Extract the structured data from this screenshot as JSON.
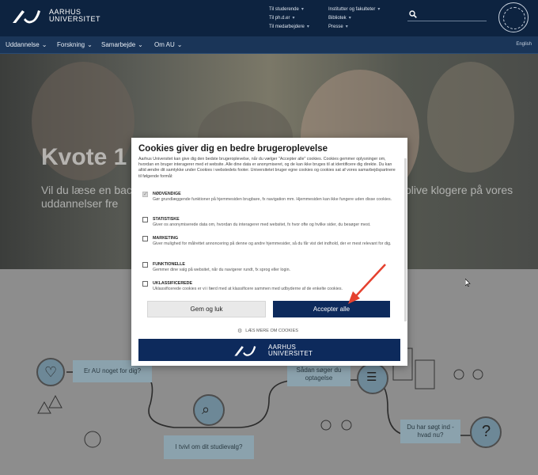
{
  "header": {
    "logo_line1": "AARHUS",
    "logo_line2": "UNIVERSITET",
    "links_col1": [
      "Til studerende",
      "Til ph.d.er",
      "Til medarbejdere"
    ],
    "links_col2": [
      "Institutter og fakulteter",
      "Bibliotek",
      "Presse"
    ],
    "search_placeholder": ""
  },
  "nav": {
    "items": [
      "Uddannelse",
      "Forskning",
      "Samarbejde",
      "Om AU"
    ],
    "language": "English"
  },
  "hero": {
    "title": "Kvote 1",
    "subtitle": "Vil du læse en bach",
    "subtitle_line2": "uddannelser fre",
    "subtitle_right": "blive klogere på vores"
  },
  "flow": {
    "box1": "Er AU noget for dig?",
    "box2": "I tvivl om dit studievalg?",
    "box3": "Sådan søger du optagelse",
    "box4": "Du har søgt ind - hvad nu?"
  },
  "cookie_dialog": {
    "title": "Cookies giver dig en bedre brugeroplevelse",
    "intro": "Aarhus Universitet kan give dig den bedste brugeroplevelse, når du vælger \"Accepter alle\" cookies. Cookies gemmer oplysninger om, hvordan en bruger interagerer med et website. Alle dine data er anonymiseret, og de kan ikke bruges til at identificere dig direkte. Du kan altid ændre dit samtykke under Cookies i webstedets footer. Universitetet bruger egne cookies og cookies sat af vores samarbejdspartnere til følgende formål:",
    "categories": [
      {
        "name": "NØDVENDIGE",
        "desc": "Gør grundlæggende funktioner på hjemmesiden brugbare, fx navigation mm. Hjemmesiden kan ikke fungere uden disse cookies.",
        "checked": true
      },
      {
        "name": "STATISTISKE",
        "desc": "Giver os anonymiserede data om, hvordan du interagerer med websitet, fx hvor ofte og hvilke sider, du besøger mest.",
        "checked": false
      },
      {
        "name": "MARKETING",
        "desc": "Giver mulighed for målrettet annoncering på denne og andre hjemmesider, så du får vist det indhold, der er mest relevant for dig.",
        "checked": false
      },
      {
        "name": "FUNKTIONELLE",
        "desc": "Gemmer dine valg på websitet, når du navigerer rundt, fx sprog eller login.",
        "checked": false
      },
      {
        "name": "UKLASSIFICEREDE",
        "desc": "Uklassificerede cookies er vi i færd med at klassificere sammen med udbyderne af de enkelte cookies.",
        "checked": false
      }
    ],
    "save_button": "Gem og luk",
    "accept_button": "Accepter alle",
    "read_more": "LÆS MERE OM COOKIES",
    "brand_line1": "AARHUS",
    "brand_line2": "UNIVERSITET"
  },
  "colors": {
    "brand_navy": "#0d2340",
    "accept_blue": "#0d2a5c",
    "arrow_red": "#e5412f"
  }
}
